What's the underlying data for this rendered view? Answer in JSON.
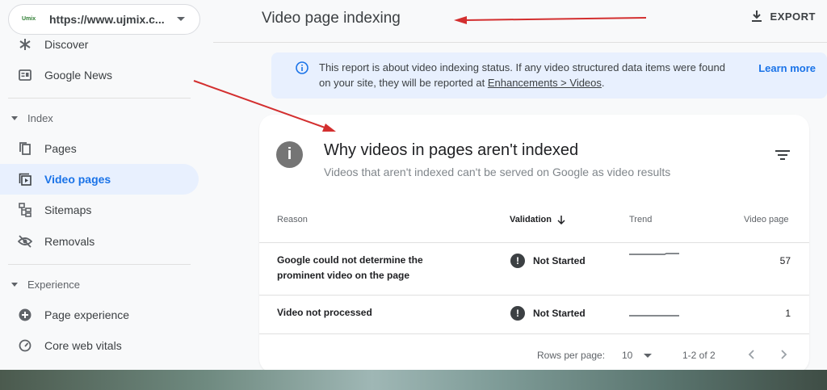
{
  "property": {
    "logo_text": "Umix",
    "url": "https://www.ujmix.c..."
  },
  "sidebar": {
    "top_items": [
      {
        "label": "Discover",
        "icon": "asterisk-icon"
      },
      {
        "label": "Google News",
        "icon": "news-icon"
      }
    ],
    "index_section": "Index",
    "index_items": [
      {
        "label": "Pages",
        "icon": "pages-icon"
      },
      {
        "label": "Video pages",
        "icon": "video-icon",
        "active": true
      },
      {
        "label": "Sitemaps",
        "icon": "sitemap-icon"
      },
      {
        "label": "Removals",
        "icon": "eye-off-icon"
      }
    ],
    "experience_section": "Experience",
    "experience_items": [
      {
        "label": "Page experience",
        "icon": "plus-circle-icon"
      },
      {
        "label": "Core web vitals",
        "icon": "gauge-icon"
      }
    ]
  },
  "header": {
    "title": "Video page indexing",
    "export_label": "EXPORT"
  },
  "info_banner": {
    "text_before": "This report is about video indexing status. If any video structured data items were found on your site, they will be reported at ",
    "link_text": "Enhancements > Videos",
    "text_after": ".",
    "learn_more": "Learn more"
  },
  "card": {
    "icon_glyph": "i",
    "title": "Why videos in pages aren't indexed",
    "subtitle": "Videos that aren't indexed can't be served on Google as video results",
    "columns": {
      "reason": "Reason",
      "validation": "Validation",
      "trend": "Trend",
      "count": "Video page"
    },
    "rows": [
      {
        "reason": "Google could not determine the prominent video on the page",
        "validation": "Not Started",
        "count": "57"
      },
      {
        "reason": "Video not processed",
        "validation": "Not Started",
        "count": "1"
      }
    ],
    "footer": {
      "rows_per_page_label": "Rows per page:",
      "rows_per_page": "10",
      "range": "1-2 of 2"
    }
  },
  "colors": {
    "accent": "#1a73e8",
    "active_bg": "#e8f0fe",
    "annotation_red": "#d32f2f"
  }
}
